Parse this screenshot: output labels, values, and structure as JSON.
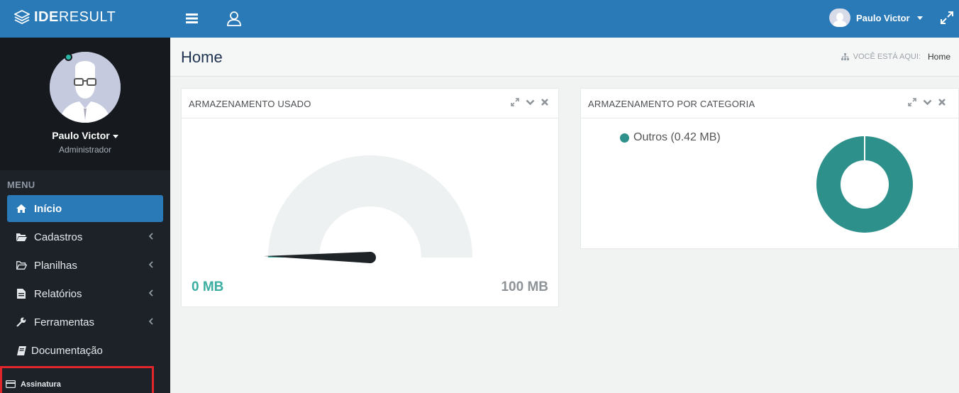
{
  "app": {
    "logo_bold": "IDE",
    "logo_light": "RESULT"
  },
  "topbar": {
    "user_name": "Paulo Victor"
  },
  "profile": {
    "name": "Paulo Victor",
    "role": "Administrador"
  },
  "menu": {
    "title": "MENU",
    "items": [
      {
        "label": "Início",
        "icon": "home-icon",
        "active": true
      },
      {
        "label": "Cadastros",
        "icon": "folder-icon",
        "has_submenu": true
      },
      {
        "label": "Planilhas",
        "icon": "folder-open-icon",
        "has_submenu": true
      },
      {
        "label": "Relatórios",
        "icon": "file-icon",
        "has_submenu": true
      },
      {
        "label": "Ferramentas",
        "icon": "wrench-icon",
        "has_submenu": true
      },
      {
        "label": "Documentação",
        "icon": "book-icon"
      },
      {
        "label": "Assinatura",
        "icon": "credit-card-icon",
        "highlighted": true
      }
    ]
  },
  "page": {
    "title": "Home",
    "breadcrumb_label": "VOCÊ ESTÁ AQUI:",
    "breadcrumb_current": "Home"
  },
  "storage_used": {
    "title": "ARMAZENAMENTO USADO",
    "min_label": "0 MB",
    "max_label": "100 MB",
    "value_fraction": 0.0042
  },
  "storage_by_category": {
    "title": "ARMAZENAMENTO POR CATEGORIA",
    "legend": [
      {
        "label": "Outros (0.42 MB)",
        "color": "#2e908a"
      }
    ]
  },
  "colors": {
    "topbar": "#2a7ab8",
    "sidebar": "#1d2229",
    "accent_teal": "#2e908a",
    "highlight_red": "#e0262a"
  },
  "chart_data": [
    {
      "type": "gauge",
      "title": "ARMAZENAMENTO USADO",
      "min": 0,
      "max": 100,
      "unit": "MB",
      "value": 0.42
    },
    {
      "type": "pie",
      "title": "ARMAZENAMENTO POR CATEGORIA",
      "labels": [
        "Outros"
      ],
      "values": [
        0.42
      ],
      "unit": "MB",
      "donut": true,
      "legend": "top-left"
    }
  ]
}
